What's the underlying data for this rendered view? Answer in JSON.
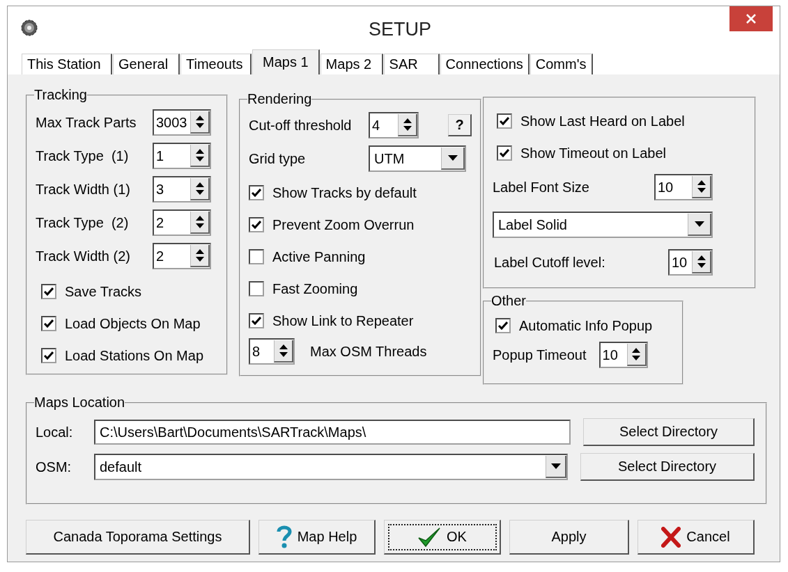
{
  "window": {
    "title": "SETUP"
  },
  "tabs": [
    {
      "label": "This Station",
      "selected": false
    },
    {
      "label": "General",
      "selected": false
    },
    {
      "label": "Timeouts",
      "selected": false
    },
    {
      "label": "Maps 1",
      "selected": true
    },
    {
      "label": "Maps 2",
      "selected": false
    },
    {
      "label": "SAR",
      "selected": false
    },
    {
      "label": "Connections",
      "selected": false
    },
    {
      "label": "Comm's",
      "selected": false
    }
  ],
  "tracking": {
    "title": "Tracking",
    "spinners": [
      {
        "label": "Max Track Parts",
        "value": "3003"
      },
      {
        "label": "Track Type  (1)",
        "value": "1"
      },
      {
        "label": "Track Width (1)",
        "value": "3"
      },
      {
        "label": "Track Type  (2)",
        "value": "2"
      },
      {
        "label": "Track Width (2)",
        "value": "2"
      }
    ],
    "checkboxes": [
      {
        "label": "Save Tracks",
        "checked": true
      },
      {
        "label": "Load Objects On Map",
        "checked": true
      },
      {
        "label": "Load Stations On Map",
        "checked": true
      }
    ]
  },
  "rendering": {
    "title": "Rendering",
    "cutoff": {
      "label": "Cut-off threshold",
      "value": "4"
    },
    "help_button": "?",
    "grid_type": {
      "label": "Grid type",
      "value": "UTM"
    },
    "checkboxes": [
      {
        "label": "Show Tracks by default",
        "checked": true
      },
      {
        "label": "Prevent Zoom Overrun",
        "checked": true
      },
      {
        "label": "Active Panning",
        "checked": false
      },
      {
        "label": "Fast Zooming",
        "checked": false
      },
      {
        "label": "Show Link to Repeater",
        "checked": true
      }
    ],
    "osm_threads": {
      "value": "8",
      "label": "Max OSM Threads"
    }
  },
  "labels": {
    "checkboxes": [
      {
        "label": "Show Last Heard on Label",
        "checked": true
      },
      {
        "label": "Show Timeout on Label",
        "checked": true
      }
    ],
    "font_size": {
      "label": "Label Font Size",
      "value": "10"
    },
    "style": {
      "value": "Label Solid"
    },
    "cutoff_level": {
      "label": "Label Cutoff level:",
      "value": "10"
    }
  },
  "other": {
    "title": "Other",
    "checkboxes": [
      {
        "label": "Automatic Info Popup",
        "checked": true
      }
    ],
    "popup_timeout": {
      "label": "Popup Timeout",
      "value": "10"
    }
  },
  "maps_location": {
    "title": "Maps Location",
    "local": {
      "label": "Local:",
      "value": "C:\\Users\\Bart\\Documents\\SARTrack\\Maps\\",
      "button": "Select Directory"
    },
    "osm": {
      "label": "OSM:",
      "value": "default",
      "button": "Select Directory"
    }
  },
  "buttons": [
    {
      "label": "Canada Toporama Settings",
      "kind": "plain",
      "focused": false
    },
    {
      "label": "Map Help",
      "kind": "help",
      "focused": false
    },
    {
      "label": "OK",
      "kind": "ok",
      "focused": true
    },
    {
      "label": "Apply",
      "kind": "plain",
      "focused": false
    },
    {
      "label": "Cancel",
      "kind": "cancel",
      "focused": false
    }
  ]
}
